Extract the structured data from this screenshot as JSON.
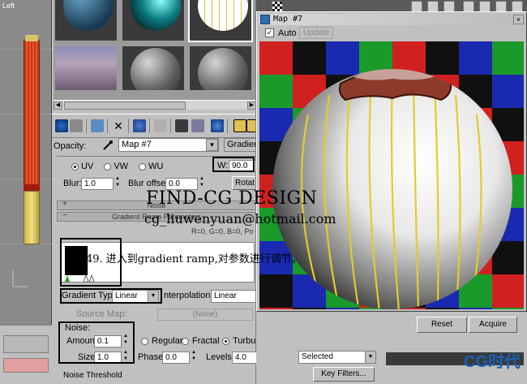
{
  "viewport": {
    "label": "Left"
  },
  "material_editor": {
    "opacity_label": "Opacity:",
    "map_name": "Map #7",
    "map_type_button": "Gradient",
    "coordinates": {
      "uv_label": "UV",
      "vw_label": "VW",
      "wu_label": "WU",
      "blur_label": "Blur:",
      "blur_value": "1.0",
      "blur_offset_label": "Blur offset:",
      "blur_offset_value": "0.0",
      "w_label": "W:",
      "w_value": "90.0",
      "rotate_button": "Rotat"
    },
    "rollouts": {
      "noise_title": "Noise",
      "gradient_ramp_title": "Gradient Ramp Parameters"
    },
    "rgb_readout": "R=0, G=0, B=0,  Po",
    "gradient_type_label": "Gradient Type:",
    "gradient_type_value": "Linear",
    "interpolation_label": "nterpolation:",
    "interpolation_value": "Linear",
    "source_map_label": "Source Map:",
    "source_map_value": "(None)",
    "noise": {
      "group_label": "Noise:",
      "amount_label": "Amount:",
      "amount_value": "0.1",
      "size_label": "Size:",
      "size_value": "1.0",
      "regular_label": "Regular",
      "fractal_label": "Fractal",
      "turbulence_label": "Turbulence",
      "phase_label": "Phase:",
      "phase_value": "0.0",
      "levels_label": "Levels:",
      "levels_value": "4.0",
      "threshold_label": "Noise Threshold"
    }
  },
  "map_window": {
    "title": "Map #7",
    "close_label": "×",
    "auto_label": "Auto",
    "auto_checked": "✓",
    "update_label": "Update"
  },
  "right_bottom": {
    "reset_label": "Reset",
    "acquire_label": "Acquire",
    "selected_value": "Selected",
    "key_filters_label": "Key Filters..."
  },
  "watermark": {
    "title": "FIND-CG DESIGN",
    "email": "cg_liuwenyuan@hotmail.com",
    "caption": "49. 进入到gradient ramp,对参数进行调节。",
    "logo_text": "CG时代"
  },
  "colors": {
    "accent": "#2e6fb0",
    "highlight": "#000000"
  }
}
